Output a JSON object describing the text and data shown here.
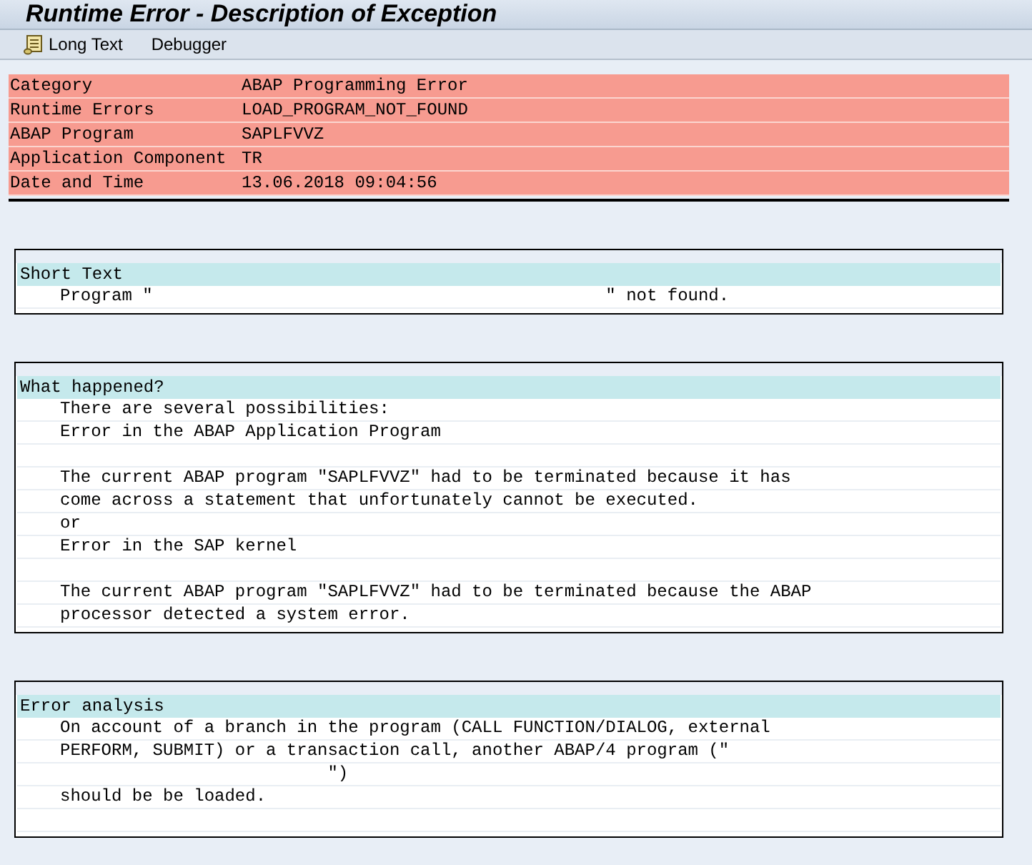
{
  "window": {
    "title": "Runtime Error - Description of Exception"
  },
  "toolbar": [
    {
      "label": "Long Text",
      "kind": "icon"
    },
    {
      "label": "Debugger",
      "kind": "plain"
    }
  ],
  "header_fields": [
    {
      "label": "Category",
      "value": "ABAP Programming Error"
    },
    {
      "label": "Runtime Errors",
      "value": "LOAD_PROGRAM_NOT_FOUND"
    },
    {
      "label": "ABAP Program",
      "value": "SAPLFVVZ"
    },
    {
      "label": "Application Component",
      "value": "TR"
    },
    {
      "label": "Date and Time",
      "value": "13.06.2018 09:04:56"
    }
  ],
  "sections": [
    {
      "title": "Short Text",
      "lines": [
        {
          "kind": "text",
          "text": "Program \"                                            \" not found."
        }
      ]
    },
    {
      "title": "What happened?",
      "lines": [
        {
          "kind": "text",
          "text": "There are several possibilities:"
        },
        {
          "kind": "text",
          "text": "Error in the ABAP Application Program"
        },
        {
          "kind": "blank"
        },
        {
          "kind": "text",
          "text": "The current ABAP program \"SAPLFVVZ\" had to be terminated because it has"
        },
        {
          "kind": "text",
          "text": "come across a statement that unfortunately cannot be executed."
        },
        {
          "kind": "text",
          "text": "or"
        },
        {
          "kind": "text",
          "text": "Error in the SAP kernel"
        },
        {
          "kind": "blank"
        },
        {
          "kind": "text",
          "text": "The current ABAP program \"SAPLFVVZ\" had to be terminated because the ABAP"
        },
        {
          "kind": "text",
          "text": "processor detected a system error."
        }
      ]
    },
    {
      "title": "Error analysis",
      "lines": [
        {
          "kind": "text",
          "text": "On account of a branch in the program (CALL FUNCTION/DIALOG, external"
        },
        {
          "kind": "text",
          "text": "PERFORM, SUBMIT) or a transaction call, another ABAP/4 program (\""
        },
        {
          "kind": "text",
          "text": "                          \")"
        },
        {
          "kind": "text",
          "text": "should be be loaded."
        },
        {
          "kind": "blank"
        }
      ]
    }
  ]
}
